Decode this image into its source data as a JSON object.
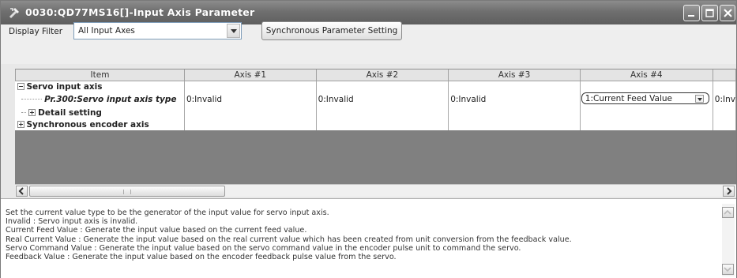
{
  "window": {
    "title": "0030:QD77MS16[]-Input Axis Parameter"
  },
  "toolbar": {
    "filter_label": "Display Filter",
    "filter_value": "All Input Axes",
    "sync_button": "Synchronous Parameter Setting"
  },
  "grid": {
    "columns": [
      "Item",
      "Axis #1",
      "Axis #2",
      "Axis #3",
      "Axis #4"
    ],
    "rows": [
      {
        "item": "Servo input axis",
        "values": [
          "",
          "",
          "",
          ""
        ]
      },
      {
        "item": "Pr.300:Servo input axis type",
        "values": [
          "0:Invalid",
          "0:Invalid",
          "0:Invalid",
          "1:Current Feed Value"
        ],
        "next_partial": "0:Inv"
      },
      {
        "item": "Detail setting",
        "values": [
          "",
          "",
          "",
          ""
        ]
      },
      {
        "item": "Synchronous encoder axis",
        "values": [
          "",
          "",
          "",
          ""
        ]
      }
    ],
    "scroll_grip": "III"
  },
  "description": {
    "lines": [
      "Set the current value type to be the generator of the input value for servo input axis.",
      "Invalid : Servo input axis is invalid.",
      "Current Feed Value : Generate the input value based on the current feed value.",
      "Real Current Value : Generate the input value based on the real current value which has been created from unit conversion from the feedback value.",
      "Servo Command Value : Generate the input value based on the servo command value in the encoder pulse unit to command the servo.",
      "Feedback Value : Generate the input value based on the encoder feedback pulse value from the servo."
    ]
  }
}
